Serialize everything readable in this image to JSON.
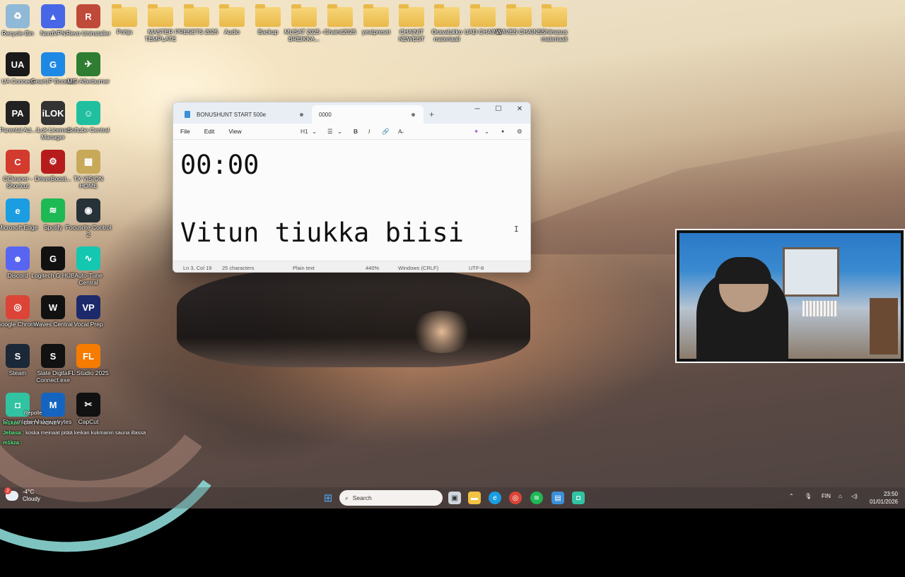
{
  "desktop": {
    "icons": [
      {
        "label": "Recycle Bin",
        "color": "#8fb9d6",
        "glyph": "♻"
      },
      {
        "label": "NordVPN",
        "color": "#4767e6",
        "glyph": "▲"
      },
      {
        "label": "Revo Uninstaller",
        "color": "#c04a3a",
        "glyph": "R"
      },
      {
        "label": "Pohja",
        "color": "folder",
        "glyph": ""
      },
      {
        "label": "MASTER TEMPLATE",
        "color": "folder",
        "glyph": ""
      },
      {
        "label": "PRESETS 2025",
        "color": "folder",
        "glyph": ""
      },
      {
        "label": "Audio",
        "color": "folder",
        "glyph": ""
      },
      {
        "label": "Backup",
        "color": "folder",
        "glyph": ""
      },
      {
        "label": "MUSAT 2025 - BREIKKA...",
        "color": "folder",
        "glyph": ""
      },
      {
        "label": "Chainit2025",
        "color": "folder",
        "glyph": ""
      },
      {
        "label": "yeatpreset",
        "color": "folder",
        "glyph": ""
      },
      {
        "label": "CHAINIT NEWEST",
        "color": "folder",
        "glyph": ""
      },
      {
        "label": "Oravalukko materiaali",
        "color": "folder",
        "glyph": ""
      },
      {
        "label": "UAD CHAINS",
        "color": "folder",
        "glyph": ""
      },
      {
        "label": "WAVES CHAINS",
        "color": "folder",
        "glyph": ""
      },
      {
        "label": "Shiinasus materiaali",
        "color": "folder",
        "glyph": ""
      },
      {
        "label": "UA Connect",
        "color": "#1a1a1a",
        "glyph": "UA"
      },
      {
        "label": "GearUP Booster",
        "color": "#1e88e5",
        "glyph": "G"
      },
      {
        "label": "MSI Afterburner",
        "color": "#2e7d32",
        "glyph": "✈"
      },
      {
        "label": "Parental Ad...",
        "color": "#222",
        "glyph": "PA"
      },
      {
        "label": "iLok License Manager",
        "color": "#333",
        "glyph": "iLOK"
      },
      {
        "label": "Softube Central",
        "color": "#1fbf9f",
        "glyph": "☺"
      },
      {
        "label": "CCleaner - Shortcut",
        "color": "#d23b2e",
        "glyph": "C"
      },
      {
        "label": "DriverBoost...",
        "color": "#b71c1c",
        "glyph": "⚙"
      },
      {
        "label": "TX VISION HOME",
        "color": "#c8a95a",
        "glyph": "▦"
      },
      {
        "label": "Microsoft Edge",
        "color": "#1b9de2",
        "glyph": "e"
      },
      {
        "label": "Spotify",
        "color": "#1db954",
        "glyph": "≋"
      },
      {
        "label": "Focusrite Control 2",
        "color": "#263238",
        "glyph": "◉"
      },
      {
        "label": "Discord",
        "color": "#5865f2",
        "glyph": "☻"
      },
      {
        "label": "Logitech G HUB",
        "color": "#111",
        "glyph": "G"
      },
      {
        "label": "Auto-Tune Central",
        "color": "#14c7b0",
        "glyph": "∿"
      },
      {
        "label": "Google Chrome",
        "color": "#db4437",
        "glyph": "◎"
      },
      {
        "label": "Waves Central",
        "color": "#111",
        "glyph": "W"
      },
      {
        "label": "Vocal Prep",
        "color": "#1c2a6b",
        "glyph": "VP"
      },
      {
        "label": "Steam",
        "color": "#1b2838",
        "glyph": "S"
      },
      {
        "label": "Slate Digital Connect.exe",
        "color": "#111",
        "glyph": "S"
      },
      {
        "label": "FL Studio 2025",
        "color": "#f57c00",
        "glyph": "FL"
      },
      {
        "label": "Streamlabs",
        "color": "#31c3a2",
        "glyph": "◘"
      },
      {
        "label": "Malwarebytes",
        "color": "#1565c0",
        "glyph": "M"
      },
      {
        "label": "CapCut",
        "color": "#111",
        "glyph": "✂"
      }
    ]
  },
  "notepad": {
    "tabs": [
      {
        "label": "BONUSHUNT START 500e",
        "active": false
      },
      {
        "label": "0000",
        "active": true
      }
    ],
    "new_tab": "+",
    "controls": {
      "minimize": "─",
      "maximize": "☐",
      "close": "✕"
    },
    "menu": {
      "file": "File",
      "edit": "Edit",
      "view": "View"
    },
    "toolbar": {
      "heading": "H1",
      "chev": "⌄",
      "list": "☰",
      "bold": "B",
      "italic": "I",
      "link": "🔗",
      "clear": "A̶",
      "copilot": "✦",
      "account": "●",
      "settings": "⚙"
    },
    "content": {
      "line1": "00:00",
      "line3": "Vitun tiukka biisi"
    },
    "status": {
      "position": "Ln 3, Col 19",
      "characters": "25 characters",
      "format": "Plain text",
      "zoom": "440%",
      "line_ending": "Windows (CRLF)",
      "encoding": "UTF-8"
    }
  },
  "chat": {
    "lines": [
      {
        "user": "m1kza :",
        "text": "DIRTY MONEY",
        "prefix": "Repolle"
      },
      {
        "user": "Jebasa :",
        "text": "koska meinaat pitää keikan kukmanin sauna illassa",
        "prefix": ""
      },
      {
        "user": "m1kza :",
        "text": "",
        "prefix": ""
      }
    ]
  },
  "taskbar": {
    "weather": {
      "temp": "-4°C",
      "condition": "Cloudy",
      "badge": "2"
    },
    "search_placeholder": "Search",
    "language": "FIN",
    "time": "23:50",
    "date": "01/01/2026"
  },
  "colors": {
    "accent": "#3b8fd9",
    "taskbar_bg": "#2b2626"
  }
}
